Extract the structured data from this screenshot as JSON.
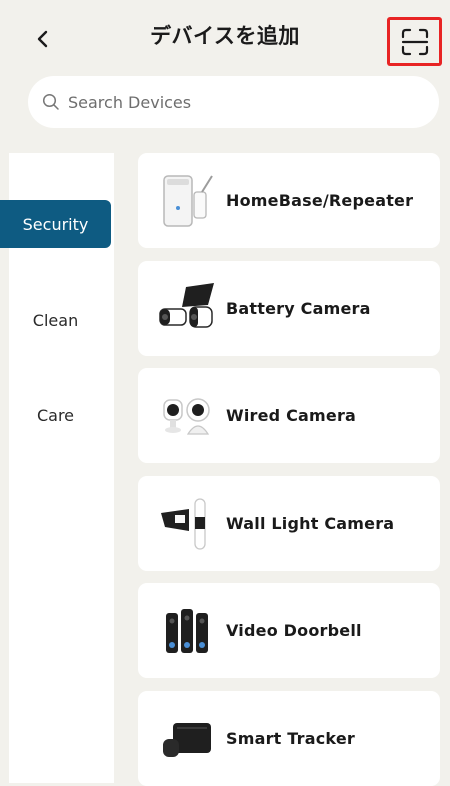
{
  "header": {
    "title": "デバイスを追加",
    "back_icon": "chevron-left-icon",
    "scan_icon": "scan-icon"
  },
  "search": {
    "placeholder": "Search Devices",
    "value": ""
  },
  "sidebar": {
    "items": [
      {
        "label": "Security",
        "active": true
      },
      {
        "label": "Clean",
        "active": false
      },
      {
        "label": "Care",
        "active": false
      }
    ]
  },
  "devices": [
    {
      "label": "HomeBase/Repeater",
      "icon": "homebase-icon"
    },
    {
      "label": "Battery Camera",
      "icon": "battery-camera-icon"
    },
    {
      "label": "Wired Camera",
      "icon": "wired-camera-icon"
    },
    {
      "label": "Wall Light Camera",
      "icon": "wall-light-camera-icon"
    },
    {
      "label": "Video Doorbell",
      "icon": "video-doorbell-icon"
    },
    {
      "label": "Smart Tracker",
      "icon": "smart-tracker-icon"
    }
  ],
  "colors": {
    "accent": "#0e5b82",
    "highlight": "#e82424",
    "background": "#f2f1ec"
  }
}
